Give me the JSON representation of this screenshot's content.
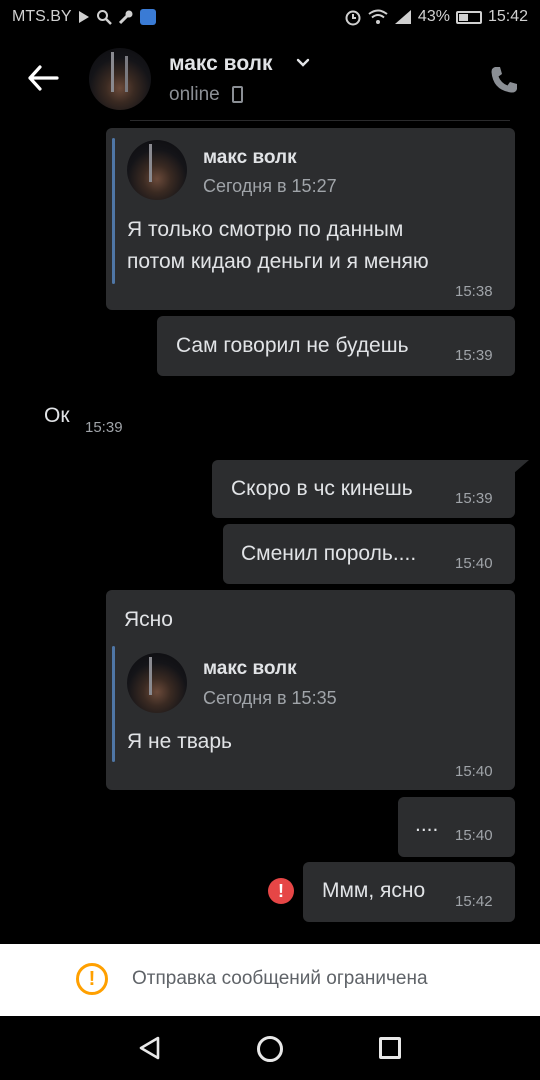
{
  "status_bar": {
    "carrier": "MTS.BY",
    "battery": "43%",
    "time": "15:42"
  },
  "header": {
    "contact_name": "макс волк",
    "status": "online"
  },
  "messages": [
    {
      "direction": "out",
      "quote": {
        "author": "макс волк",
        "date": "Сегодня в 15:27",
        "text_line1": "Я только смотрю по данным",
        "text_line2": "потом кидаю деньги и я меняю"
      },
      "time": "15:38"
    },
    {
      "direction": "out",
      "text": "Сам говорил не будешь",
      "time": "15:39"
    },
    {
      "direction": "in",
      "text": "Ок",
      "time": "15:39"
    },
    {
      "direction": "out",
      "text": "Скоро в чс кинешь",
      "time": "15:39"
    },
    {
      "direction": "out",
      "text": "Сменил пороль....",
      "time": "15:40"
    },
    {
      "direction": "out",
      "text": "Ясно",
      "quote": {
        "author": "макс волк",
        "date": "Сегодня в 15:35",
        "text": "Я не тварь"
      },
      "time": "15:40"
    },
    {
      "direction": "out",
      "text": "....",
      "time": "15:40"
    },
    {
      "direction": "out",
      "text": "Ммм, ясно",
      "time": "15:42",
      "error": true
    }
  ],
  "restriction": {
    "text": "Отправка сообщений ограничена",
    "color": "#ffa000"
  },
  "colors": {
    "bubble": "#2c2d2f",
    "quote_bar": "#4f76a6",
    "error": "#e64646"
  }
}
